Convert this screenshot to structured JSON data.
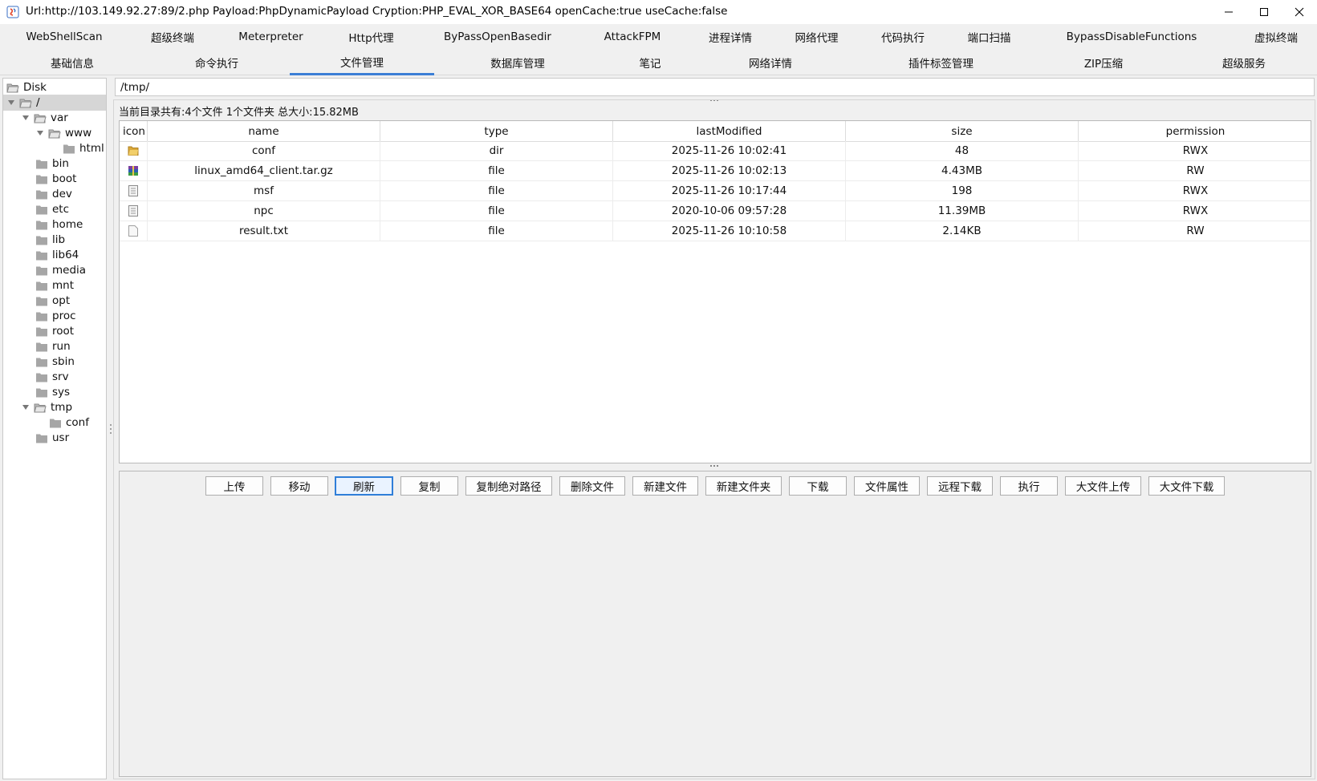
{
  "window": {
    "title": "Url:http://103.149.92.27:89/2.php Payload:PhpDynamicPayload Cryption:PHP_EVAL_XOR_BASE64 openCache:true useCache:false"
  },
  "tabs_row1": [
    "WebShellScan",
    "超级终端",
    "Meterpreter",
    "Http代理",
    "ByPassOpenBasedir",
    "AttackFPM",
    "进程详情",
    "网络代理",
    "代码执行",
    "端口扫描",
    "BypassDisableFunctions",
    "虚拟终端"
  ],
  "tabs_row2": [
    "基础信息",
    "命令执行",
    "文件管理",
    "数据库管理",
    "笔记",
    "网络详情",
    "插件标签管理",
    "ZIP压缩",
    "超级服务"
  ],
  "active_tab": "文件管理",
  "tree": {
    "root": "Disk",
    "slash": "/",
    "var": "var",
    "www": "www",
    "html": "html",
    "dirs": [
      "bin",
      "boot",
      "dev",
      "etc",
      "home",
      "lib",
      "lib64",
      "media",
      "mnt",
      "opt",
      "proc",
      "root",
      "run",
      "sbin",
      "srv",
      "sys"
    ],
    "tmp": "tmp",
    "tmp_conf": "conf",
    "usr": "usr"
  },
  "path": "/tmp/",
  "summary": "当前目录共有:4个文件 1个文件夹 总大小:15.82MB",
  "table": {
    "headers": [
      "icon",
      "name",
      "type",
      "lastModified",
      "size",
      "permission"
    ],
    "rows": [
      {
        "icon": "folder-icon",
        "name": "conf",
        "type": "dir",
        "lastModified": "2025-11-26 10:02:41",
        "size": "48",
        "permission": "RWX"
      },
      {
        "icon": "archive-icon",
        "name": "linux_amd64_client.tar.gz",
        "type": "file",
        "lastModified": "2025-11-26 10:02:13",
        "size": "4.43MB",
        "permission": "RW"
      },
      {
        "icon": "file-icon",
        "name": "msf",
        "type": "file",
        "lastModified": "2025-11-26 10:17:44",
        "size": "198",
        "permission": "RWX"
      },
      {
        "icon": "file-icon",
        "name": "npc",
        "type": "file",
        "lastModified": "2020-10-06 09:57:28",
        "size": "11.39MB",
        "permission": "RWX"
      },
      {
        "icon": "text-file-icon",
        "name": "result.txt",
        "type": "file",
        "lastModified": "2025-11-26 10:10:58",
        "size": "2.14KB",
        "permission": "RW"
      }
    ]
  },
  "buttons": [
    "上传",
    "移动",
    "刷新",
    "复制",
    "复制绝对路径",
    "删除文件",
    "新建文件",
    "新建文件夹",
    "下载",
    "文件属性",
    "远程下载",
    "执行",
    "大文件上传",
    "大文件下载"
  ],
  "focused_button": "刷新",
  "colors": {
    "accent": "#3c7fd6",
    "folder": "#d9a83a"
  }
}
